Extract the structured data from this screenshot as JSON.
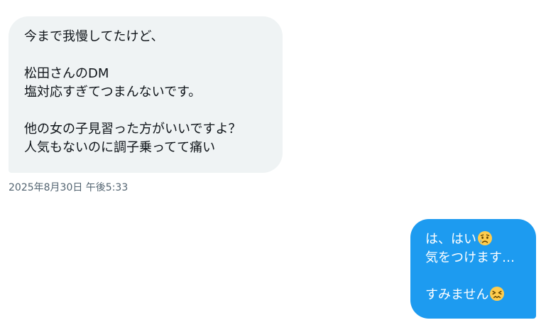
{
  "incoming_message": {
    "lines": [
      "今まで我慢してたけど、",
      "",
      "松田さんのDM",
      "塩対応すぎてつまんないです。",
      "",
      "他の女の子見習った方がいいですよ？",
      "人気もないのに調子乗ってて痛い"
    ],
    "timestamp": "2025年8月30日 午後5:33"
  },
  "outgoing_message": {
    "lines": [
      {
        "text": "は、はい",
        "emoji": "crying-face-icon"
      },
      {
        "text": "気をつけます…"
      },
      {
        "text": ""
      },
      {
        "text": "すみません",
        "emoji": "confounded-face-icon"
      }
    ]
  },
  "colors": {
    "incoming_bubble": "#eff3f4",
    "outgoing_bubble": "#1d9bf0",
    "timestamp_text": "#536471",
    "emoji_face": "#ffcc4d"
  }
}
